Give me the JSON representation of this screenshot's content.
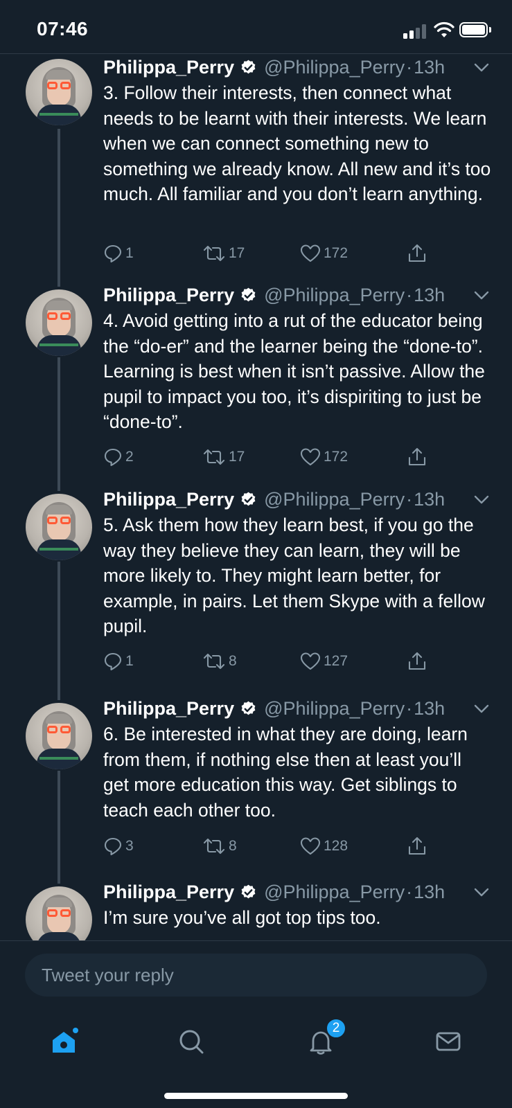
{
  "status_bar": {
    "time": "07:46"
  },
  "tweets": [
    {
      "name": "Philippa_Perry",
      "handle": "@Philippa_Perry",
      "separator": "·",
      "time": "13h",
      "text": "3. Follow their interests, then connect what needs to be learnt with their interests. We learn when we can connect something new to something we already know. All new and it’s too much. All familiar and you don’t learn anything.",
      "replies": "1",
      "retweets": "17",
      "likes": "172"
    },
    {
      "name": "Philippa_Perry",
      "handle": "@Philippa_Perry",
      "separator": "·",
      "time": "13h",
      "text": "4. Avoid getting into a rut of the educator being the “do-er” and the learner being the “done-to”. Learning is best when it isn’t passive. Allow the pupil to impact you too, it’s dispiriting to just be “done-to”.",
      "replies": "2",
      "retweets": "17",
      "likes": "172"
    },
    {
      "name": "Philippa_Perry",
      "handle": "@Philippa_Perry",
      "separator": "·",
      "time": "13h",
      "text": "5. Ask them how they learn best, if you go the way they believe they can learn, they will be more likely to. They might learn better, for example, in pairs. Let them Skype with a fellow pupil.",
      "replies": "1",
      "retweets": "8",
      "likes": "127"
    },
    {
      "name": "Philippa_Perry",
      "handle": "@Philippa_Perry",
      "separator": "·",
      "time": "13h",
      "text": "6. Be interested in what they are doing, learn from them, if nothing else then at least you’ll get more education this way. Get siblings to teach each other too.",
      "replies": "3",
      "retweets": "8",
      "likes": "128"
    },
    {
      "name": "Philippa_Perry",
      "handle": "@Philippa_Perry",
      "separator": "·",
      "time": "13h",
      "text": "I’m sure you’ve all got top tips too.",
      "replies": "",
      "retweets": "",
      "likes": ""
    }
  ],
  "reply": {
    "placeholder": "Tweet your reply"
  },
  "tab_bar": {
    "tabs": [
      "home-icon",
      "search-icon",
      "notifications-icon",
      "messages-icon"
    ],
    "notifications_badge": "2"
  },
  "colors": {
    "background": "#15202b",
    "accent": "#1da1f2",
    "secondary_text": "#8899a6"
  }
}
